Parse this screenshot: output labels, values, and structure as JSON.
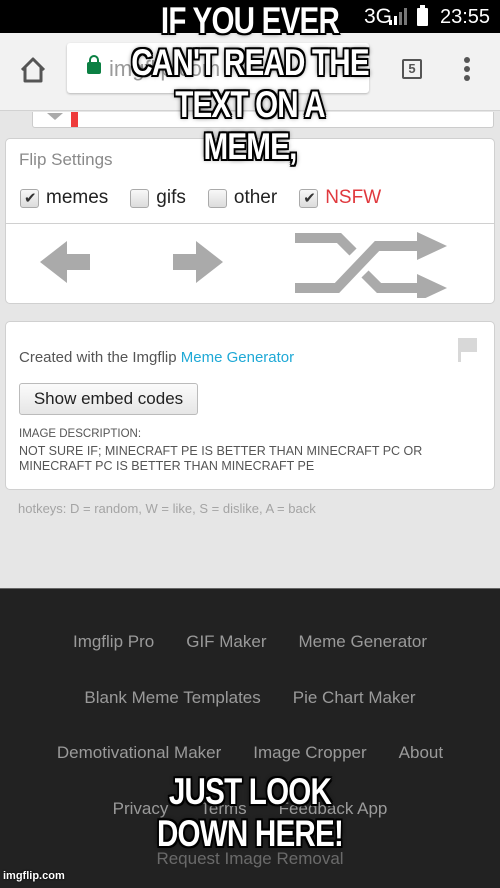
{
  "status_bar": {
    "network": "3G",
    "network_badge": "3G",
    "time": "23:55"
  },
  "browser": {
    "url": "imgflip.com",
    "tab_count": "5",
    "icons": {
      "home": "home-icon",
      "lock": "lock-icon",
      "tabs": "tab-switcher-icon",
      "menu": "kebab-menu-icon"
    }
  },
  "flip_settings": {
    "title": "Flip Settings",
    "options": [
      {
        "label": "memes",
        "checked": true,
        "color": "#222222"
      },
      {
        "label": "gifs",
        "checked": false,
        "color": "#222222"
      },
      {
        "label": "other",
        "checked": false,
        "color": "#222222"
      },
      {
        "label": "NSFW",
        "checked": true,
        "color": "#e0393e"
      }
    ],
    "buttons": {
      "prev": "left-arrow-icon",
      "next": "right-arrow-icon",
      "random": "shuffle-icon"
    }
  },
  "info": {
    "created_prefix": "Created with the Imgflip ",
    "created_link": "Meme Generator",
    "embed_button": "Show embed codes",
    "description_label": "IMAGE DESCRIPTION:",
    "description_text": "NOT SURE IF; MINECRAFT PE IS BETTER THAN MINECRAFT PC OR MINECRAFT PC IS BETTER THAN MINECRAFT PE",
    "flag_icon": "flag-icon"
  },
  "hotkeys": "hotkeys: D = random, W = like, S = dislike, A = back",
  "footer": {
    "rows": [
      [
        "Imgflip Pro",
        "GIF Maker",
        "Meme Generator"
      ],
      [
        "Blank Meme Templates",
        "Pie Chart Maker"
      ],
      [
        "Demotivational Maker",
        "Image Cropper",
        "About"
      ],
      [
        "Privacy",
        "Terms",
        "Feedback App"
      ],
      [
        "Request Image Removal"
      ]
    ]
  },
  "meme": {
    "top_text": "IF YOU EVER CAN'T READ THE TEXT ON A MEME,",
    "bottom_text": "JUST LOOK DOWN HERE!",
    "watermark": "imgflip.com"
  },
  "colors": {
    "link": "#1fa9d6",
    "nsfw": "#e0393e",
    "footer_bg": "#222222",
    "page_bg": "#e6e6e6",
    "lock": "#0b8043"
  }
}
